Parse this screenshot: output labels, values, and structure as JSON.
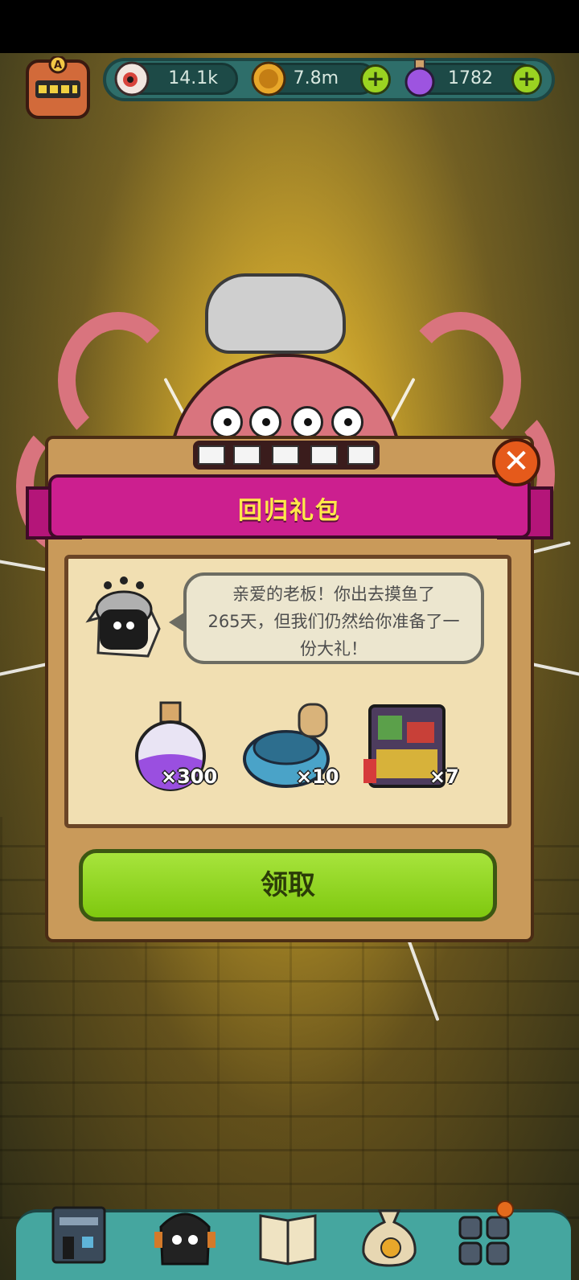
{
  "hud": {
    "eyes": {
      "icon": "eyeball-icon",
      "value": "14.1k"
    },
    "coins": {
      "icon": "gold-coin-icon",
      "value": "7.8m",
      "add_icon": "plus-icon"
    },
    "potions": {
      "icon": "purple-potion-icon",
      "value": "1782",
      "add_icon": "plus-icon"
    },
    "avatar_badge": "A"
  },
  "dialog": {
    "title": "回归礼包",
    "message_line1": "亲爱的老板！你出去摸鱼了",
    "message_line2": "265天，但我们仍然给你准备了一",
    "message_line3": "份大礼！",
    "rewards": [
      {
        "icon": "purple-potion-icon",
        "quantity": "×300"
      },
      {
        "icon": "blue-pot-icon",
        "quantity": "×10"
      },
      {
        "icon": "treasure-chest-icon",
        "quantity": "×7"
      }
    ],
    "claim_label": "领取",
    "close_icon": "close-icon"
  },
  "colors": {
    "ribbon": "#cc1f8f",
    "title_text": "#ffe84a",
    "claim_button": "#8fd620",
    "close_button": "#e55a1b",
    "hud_bar": "#2e6e6a"
  },
  "bottom_nav": [
    {
      "icon": "building-icon"
    },
    {
      "icon": "monster-icon"
    },
    {
      "icon": "book-icon"
    },
    {
      "icon": "money-bag-icon"
    },
    {
      "icon": "grid-menu-icon",
      "badge": true
    }
  ]
}
